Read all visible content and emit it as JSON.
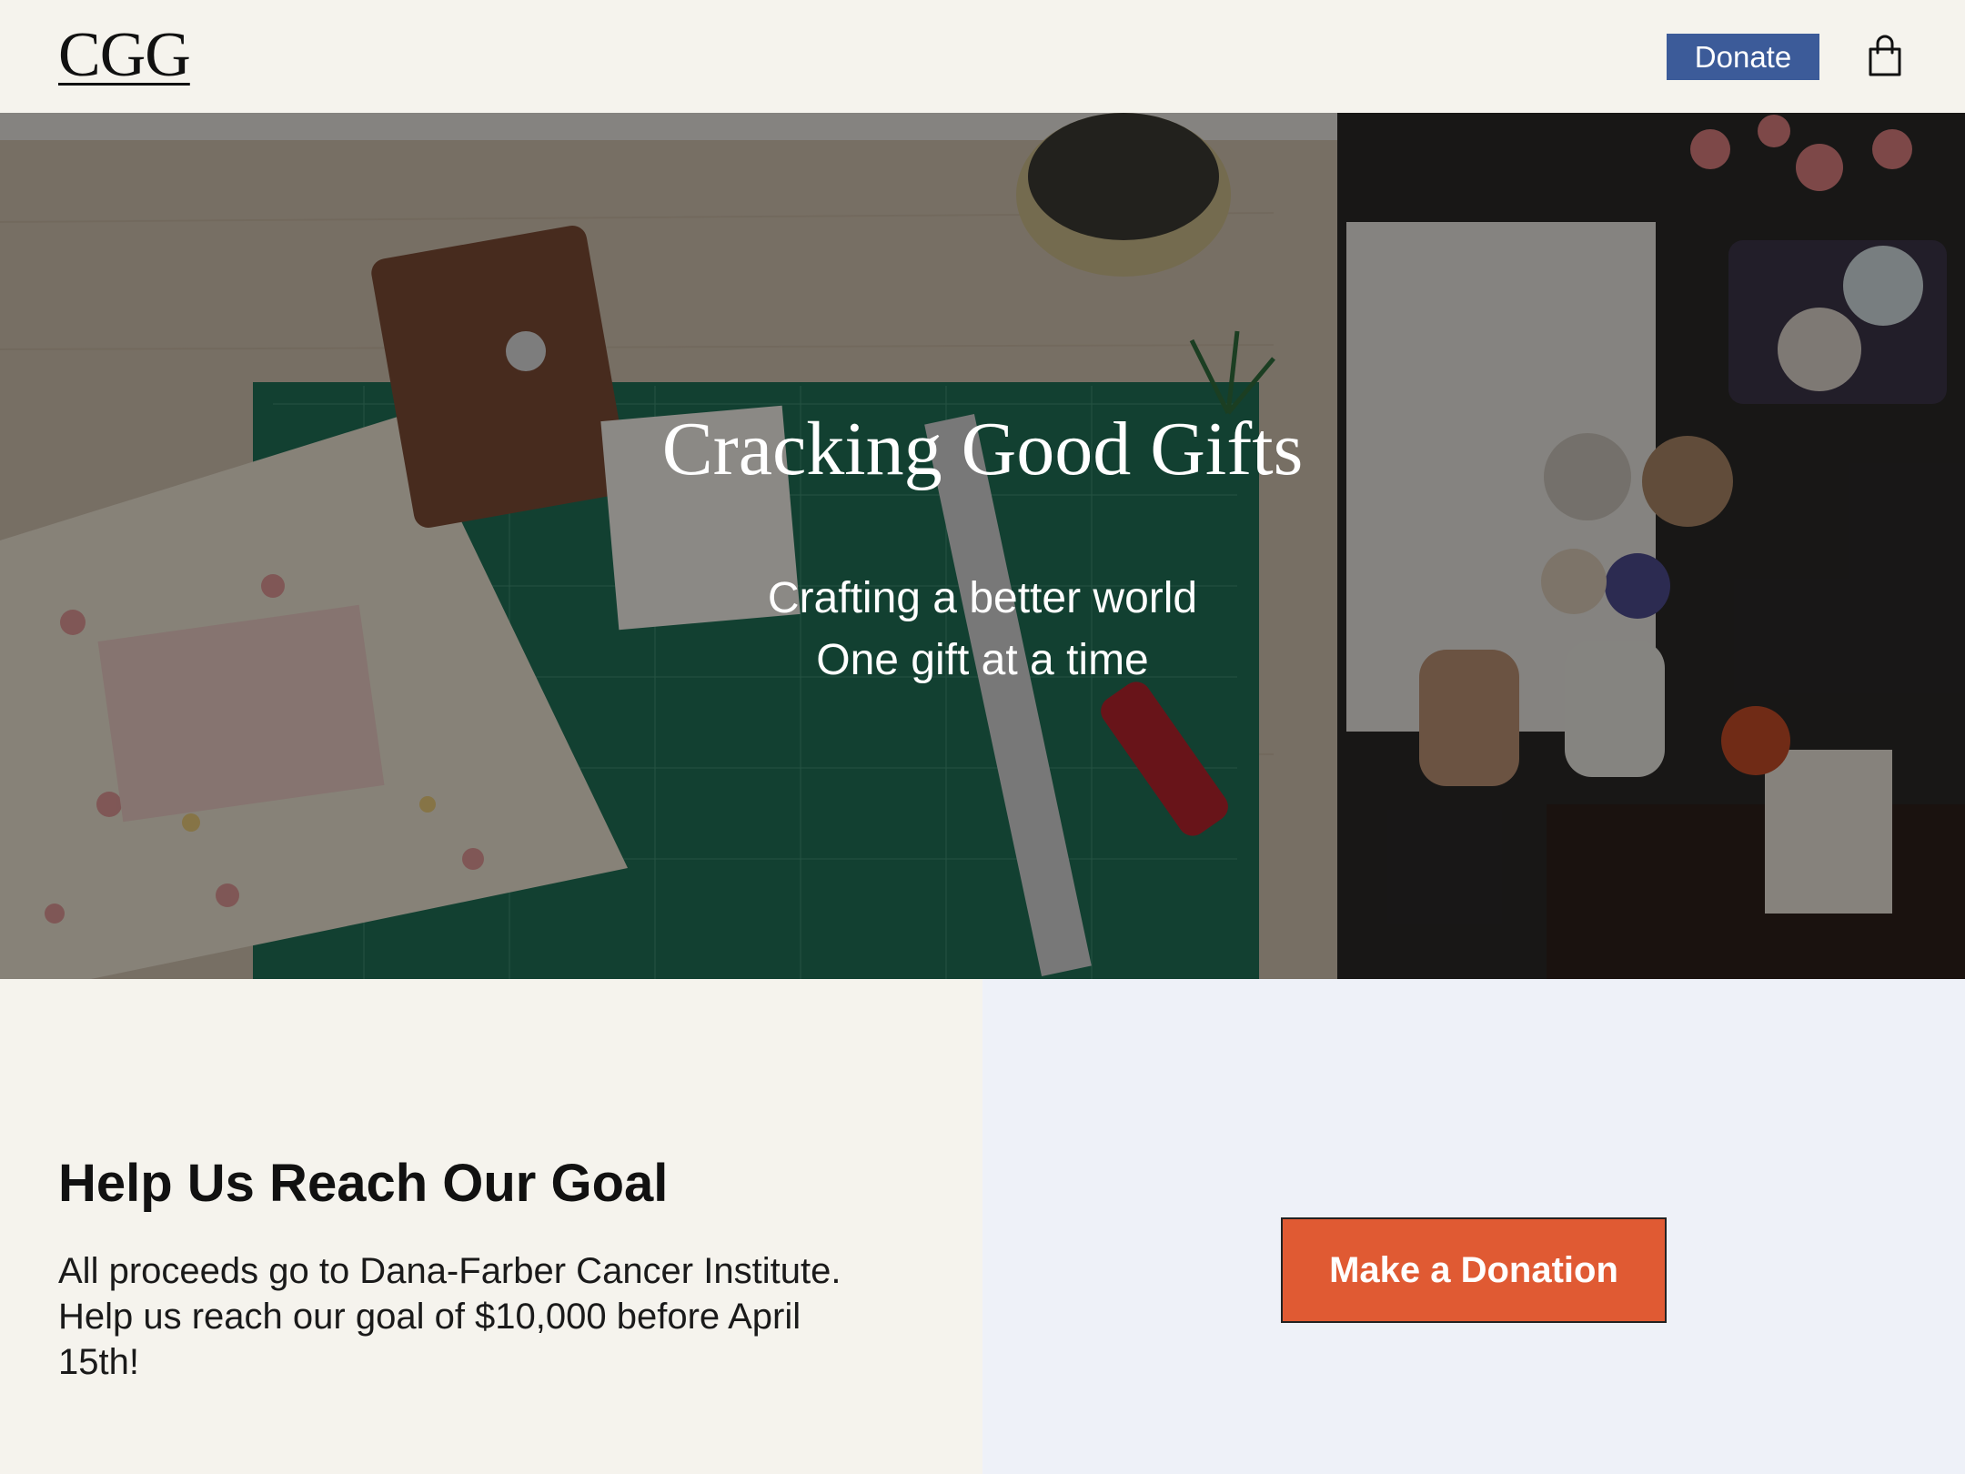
{
  "header": {
    "logo": "CGG",
    "donate_label": "Donate",
    "cart_icon": "shopping-bag-icon"
  },
  "hero": {
    "title": "Cracking Good Gifts",
    "subtitle_line1": "Crafting a better world",
    "subtitle_line2": "One gift at a time"
  },
  "goal": {
    "title": "Help Us Reach Our Goal",
    "text": "All proceeds go to Dana-Farber Cancer Institute. Help us reach our goal of $10,000 before April 15th!"
  },
  "donation": {
    "button_label": "Make a Donation"
  },
  "colors": {
    "background": "#f5f3ed",
    "donate_button": "#3c5b99",
    "cta_button": "#e05a33",
    "right_panel": "#eef1f8"
  }
}
